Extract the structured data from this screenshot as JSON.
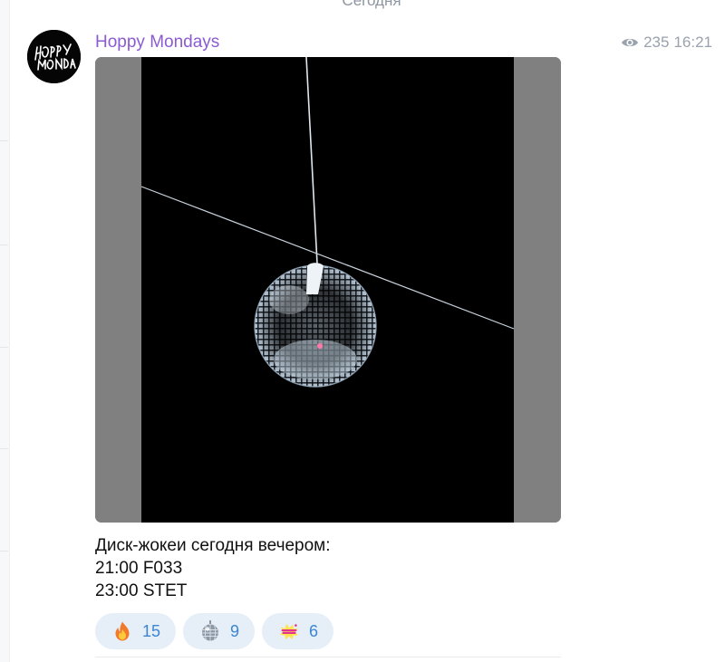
{
  "date_divider": "Сегодня",
  "post": {
    "sender": "Hoppy Mondays",
    "views": "235",
    "time": "16:21",
    "caption_lines": [
      "Диск-жокеи сегодня вечером:",
      "21:00 F033",
      "23:00 STET"
    ],
    "reactions": [
      {
        "emoji": "fire-emoji",
        "count": "15"
      },
      {
        "emoji": "mirror-ball-emoji",
        "count": "9"
      },
      {
        "emoji": "sticker-emoji",
        "count": "6"
      }
    ]
  },
  "colors": {
    "sender": "#8a5bd1",
    "reaction_bg": "#e6eef8",
    "reaction_text": "#3b86d2",
    "meta": "#99a2ad"
  }
}
